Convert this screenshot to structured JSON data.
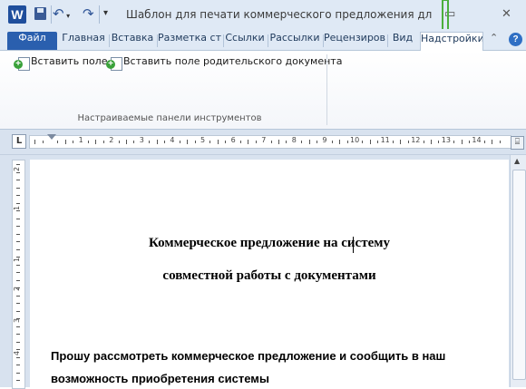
{
  "titlebar": {
    "app_icon_letter": "W",
    "title": "Шаблон для печати коммерческого предложения для Fo...",
    "min": "▭",
    "close": "✕"
  },
  "tabs": [
    {
      "label": "Файл"
    },
    {
      "label": "Главная"
    },
    {
      "label": "Вставка"
    },
    {
      "label": "Разметка ст"
    },
    {
      "label": "Ссылки"
    },
    {
      "label": "Рассылки"
    },
    {
      "label": "Рецензиров"
    },
    {
      "label": "Вид"
    },
    {
      "label": "Надстройки"
    }
  ],
  "ribbon": {
    "btn_insert_field": "Вставить поле",
    "btn_insert_parent_field": "Вставить поле родительского документа",
    "group_label": "Настраиваемые панели инструментов"
  },
  "ruler": {
    "tab_btn": "L",
    "numbers": [
      "1",
      "2",
      "3",
      "4",
      "5",
      "6",
      "7",
      "8",
      "9",
      "10",
      "11",
      "12",
      "13",
      "14"
    ],
    "vnumbers": [
      "2",
      "1",
      "1",
      "2",
      "3",
      "4"
    ]
  },
  "document": {
    "title_line1": "Коммерческое предложение на систему",
    "title_line2": "совместной работы с документами",
    "body_line1": "Прошу рассмотреть коммерческое предложение и сообщить в наш",
    "body_line2": "возможность приобретения системы"
  },
  "colors": {
    "accent": "#2a5fae",
    "annotation_arrow": "#4caf3c"
  }
}
